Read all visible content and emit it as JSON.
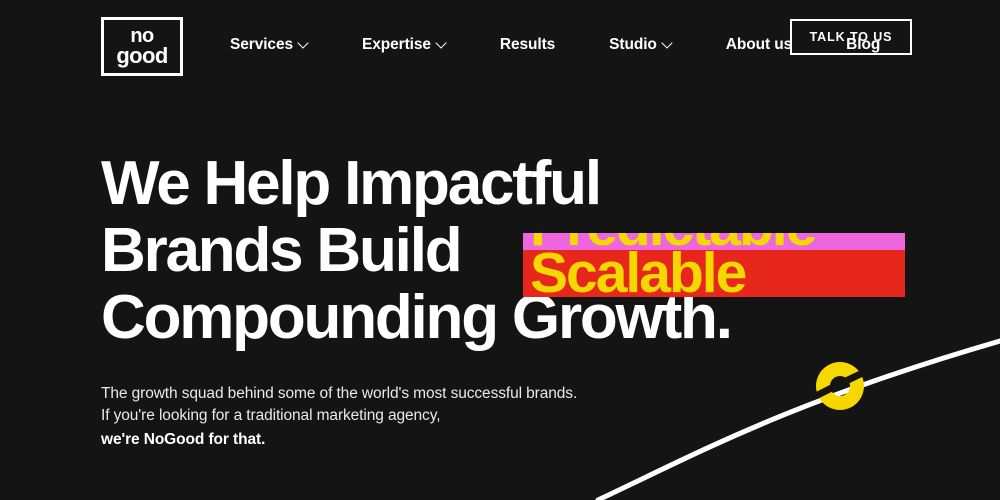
{
  "site": {
    "background_color": "#141414",
    "logo": {
      "line1": "no",
      "line2": "good",
      "name": "NoGood"
    }
  },
  "header": {
    "nav_items": [
      {
        "label": "Services",
        "has_dropdown": true
      },
      {
        "label": "Expertise",
        "has_dropdown": true
      },
      {
        "label": "Results",
        "has_dropdown": false
      },
      {
        "label": "Studio",
        "has_dropdown": true
      },
      {
        "label": "About us",
        "has_dropdown": false
      },
      {
        "label": "Blog",
        "has_dropdown": false
      }
    ],
    "cta_label": "TALK TO US"
  },
  "hero": {
    "headline_line1": "We Help Impactful",
    "headline_line2": "Brands Build",
    "headline_line3": "Compounding Growth.",
    "rotator": {
      "outgoing_word": "Predictable",
      "incoming_word": "Scalable",
      "outgoing_bg": "#ee66dd",
      "incoming_bg": "#e8271c",
      "word_color": "#f5d800"
    },
    "subcopy": {
      "line1": "The growth squad behind some of the world's most successful brands.",
      "line2": "If you're looking for a traditional marketing agency,",
      "line3": "we're NoGood for that."
    }
  },
  "decoration": {
    "curve_color": "#ffffff",
    "node_color": "#f5d800"
  }
}
